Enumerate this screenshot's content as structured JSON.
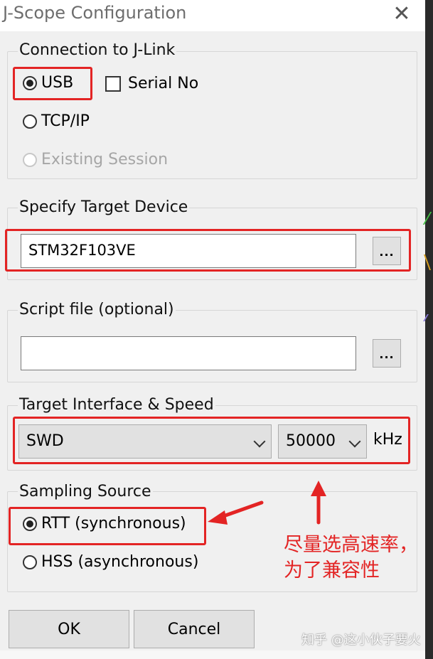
{
  "window": {
    "title": "J-Scope Configuration"
  },
  "connection": {
    "legend": "Connection to J-Link",
    "usb_label": "USB",
    "serial_label": "Serial No",
    "tcpip_label": "TCP/IP",
    "existing_label": "Existing Session",
    "selected": "USB"
  },
  "target_device": {
    "legend": "Specify Target Device",
    "value": "STM32F103VE",
    "browse_label": "..."
  },
  "script_file": {
    "legend": "Script file (optional)",
    "value": "",
    "browse_label": "..."
  },
  "interface_speed": {
    "legend": "Target Interface & Speed",
    "interface_value": "SWD",
    "speed_value": "50000",
    "unit": "kHz"
  },
  "sampling": {
    "legend": "Sampling Source",
    "rtt_label": "RTT (synchronous)",
    "hss_label": "HSS (asynchronous)",
    "selected": "RTT"
  },
  "buttons": {
    "ok": "OK",
    "cancel": "Cancel"
  },
  "annotation": {
    "line1": "尽量选高速率，",
    "line2": "为了兼容性"
  },
  "watermark": "知乎 @这小伙子要火",
  "colors": {
    "annotation_red": "#e32424",
    "dialog_bg": "#f0f0f0"
  }
}
